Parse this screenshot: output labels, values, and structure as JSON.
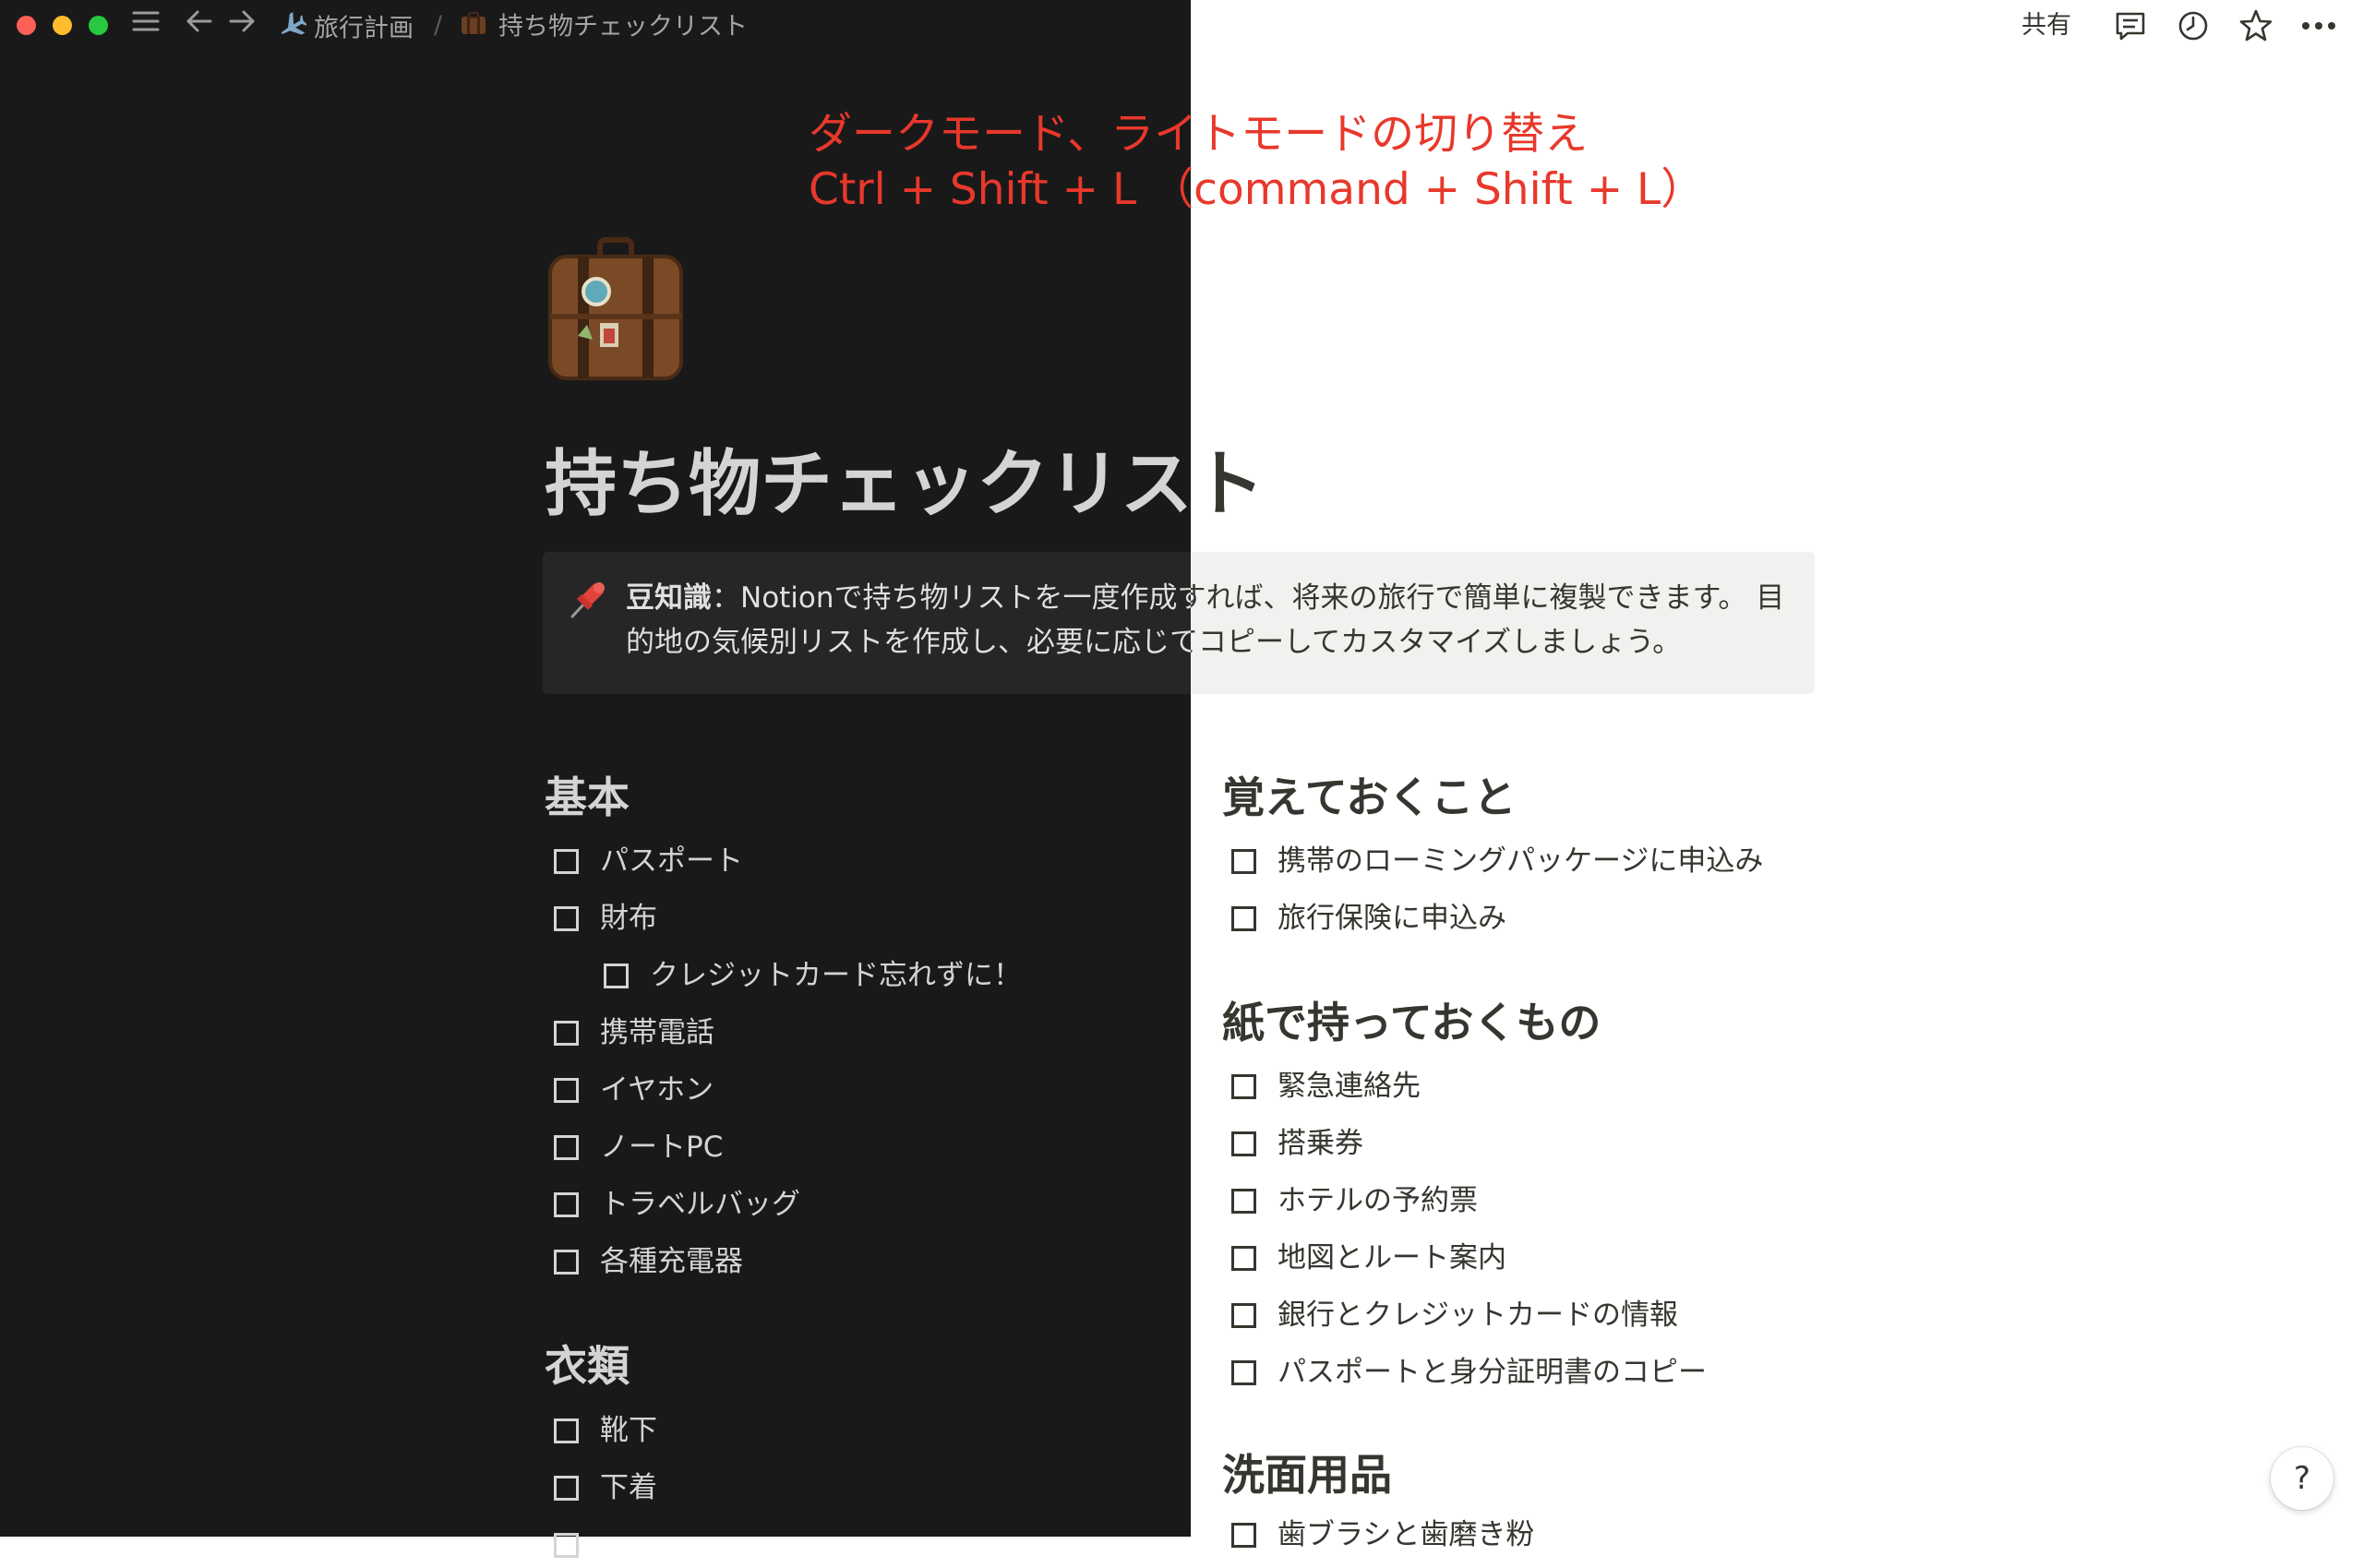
{
  "topbar": {
    "breadcrumb_parent": "旅行計画",
    "breadcrumb_separator": "/",
    "breadcrumb_current": "持ち物チェックリスト",
    "share_label": "共有"
  },
  "annotation": {
    "line1": "ダークモード、ライトモードの切り替え",
    "line2": "Ctrl + Shift + L （command + Shift + L）"
  },
  "page": {
    "title": "持ち物チェックリスト"
  },
  "callout": {
    "bold": "豆知識",
    "text": "：Notionで持ち物リストを一度作成すれば、将来の旅行で簡単に複製できます。 目的地の気候別リストを作成し、必要に応じてコピーしてカスタマイズしましょう。"
  },
  "left_sections": [
    {
      "heading": "基本",
      "items": [
        "パスポート",
        "財布",
        "クレジットカード忘れずに！",
        "携帯電話",
        "イヤホン",
        "ノートPC",
        "トラベルバッグ",
        "各種充電器"
      ]
    },
    {
      "heading": "衣類",
      "items": [
        "靴下",
        "下着"
      ]
    }
  ],
  "right_sections": [
    {
      "heading": "覚えておくこと",
      "items": [
        "携帯のローミングパッケージに申込み",
        "旅行保険に申込み"
      ]
    },
    {
      "heading": "紙で持っておくもの",
      "items": [
        "緊急連絡先",
        "搭乗券",
        "ホテルの予約票",
        "地図とルート案内",
        "銀行とクレジットカードの情報",
        "パスポートと身分証明書のコピー"
      ]
    },
    {
      "heading": "洗面用品",
      "items": [
        "歯ブラシと歯磨き粉"
      ]
    }
  ],
  "help_label": "?",
  "colors": {
    "dark_bg": "#191919",
    "light_bg": "#ffffff",
    "annotation_red": "#e8382b",
    "text_light": "#d4d4d4",
    "text_dark": "#37352f"
  },
  "icons": {
    "breadcrumb_parent_icon": "airplane-icon",
    "breadcrumb_current_icon": "suitcase-icon",
    "page_icon": "suitcase-icon",
    "callout_icon": "pushpin-icon"
  }
}
